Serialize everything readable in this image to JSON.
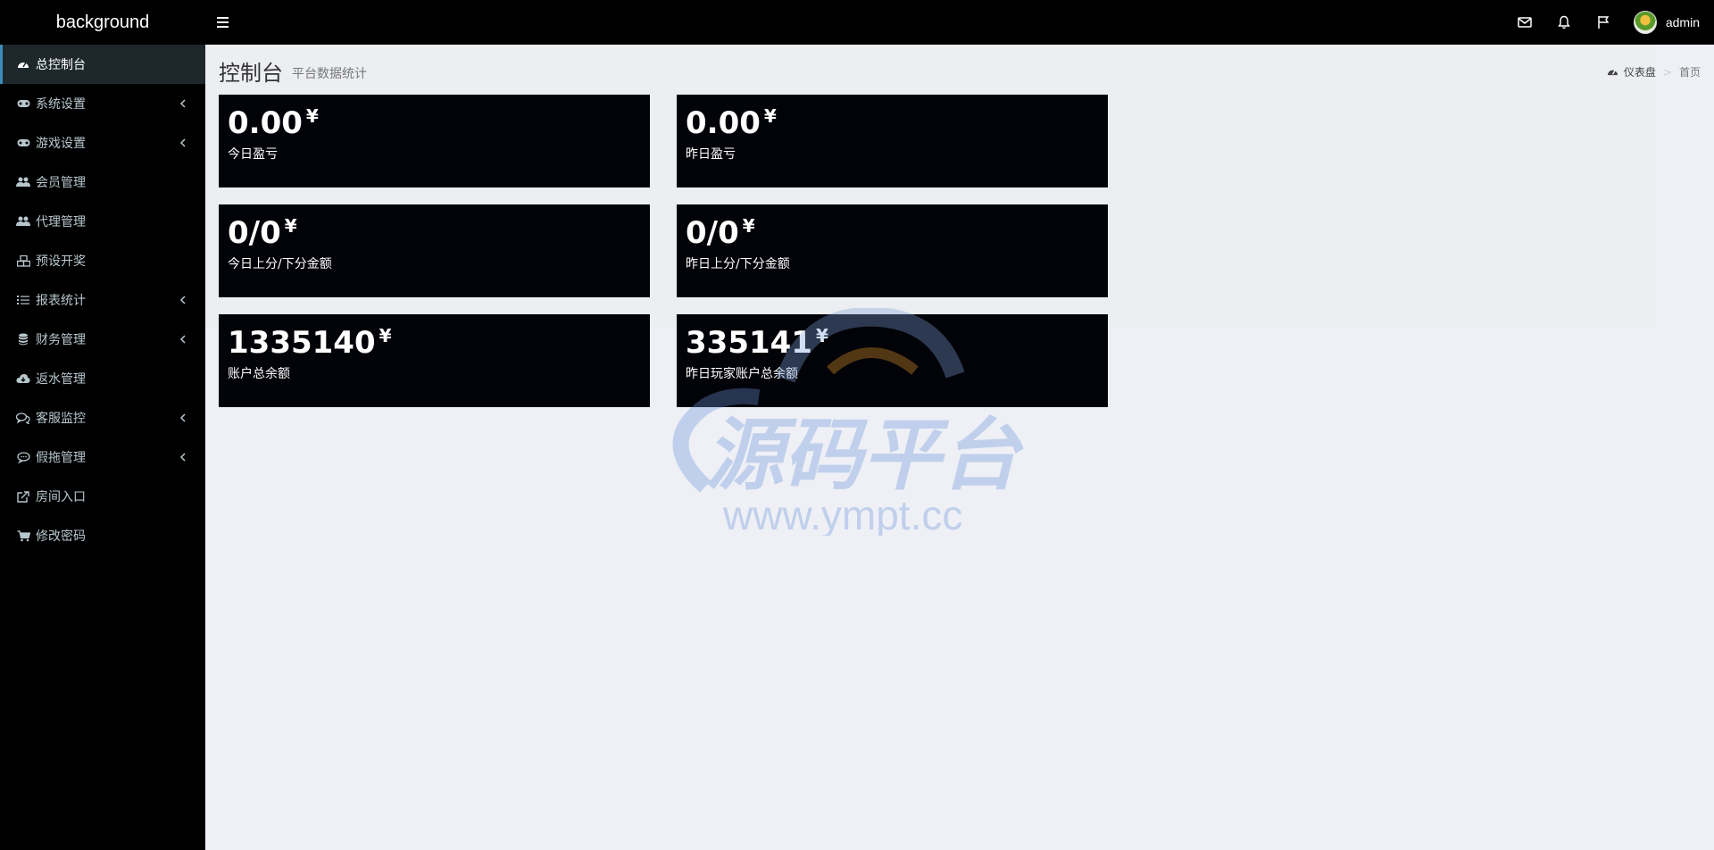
{
  "header": {
    "logo": "background",
    "username": "admin",
    "icons": [
      "menu-toggle-icon",
      "envelope-icon",
      "bell-icon",
      "flag-icon"
    ]
  },
  "sidebar": {
    "items": [
      {
        "label": "总控制台",
        "icon": "dashboard-icon",
        "active": true,
        "has_children": false
      },
      {
        "label": "系统设置",
        "icon": "gamepad-icon",
        "active": false,
        "has_children": true
      },
      {
        "label": "游戏设置",
        "icon": "gamepad-icon",
        "active": false,
        "has_children": true
      },
      {
        "label": "会员管理",
        "icon": "users-icon",
        "active": false,
        "has_children": false
      },
      {
        "label": "代理管理",
        "icon": "users-icon",
        "active": false,
        "has_children": false
      },
      {
        "label": "预设开奖",
        "icon": "cubes-icon",
        "active": false,
        "has_children": false
      },
      {
        "label": "报表统计",
        "icon": "list-icon",
        "active": false,
        "has_children": true
      },
      {
        "label": "财务管理",
        "icon": "database-icon",
        "active": false,
        "has_children": true
      },
      {
        "label": "返水管理",
        "icon": "cloud-download-icon",
        "active": false,
        "has_children": false
      },
      {
        "label": "客服监控",
        "icon": "comments-icon",
        "active": false,
        "has_children": true
      },
      {
        "label": "假拖管理",
        "icon": "comment-icon",
        "active": false,
        "has_children": true
      },
      {
        "label": "房间入口",
        "icon": "external-link-icon",
        "active": false,
        "has_children": false
      },
      {
        "label": "修改密码",
        "icon": "cart-icon",
        "active": false,
        "has_children": false
      }
    ]
  },
  "page": {
    "title": "控制台",
    "subtitle": "平台数据统计",
    "breadcrumb": {
      "home": "仪表盘",
      "current": "首页"
    }
  },
  "stats": [
    {
      "value": "0.00",
      "unit": "¥",
      "label": "今日盈亏"
    },
    {
      "value": "0.00",
      "unit": "¥",
      "label": "昨日盈亏"
    },
    {
      "value": "0/0",
      "unit": "¥",
      "label": "今日上分/下分金额"
    },
    {
      "value": "0/0",
      "unit": "¥",
      "label": "昨日上分/下分金额"
    },
    {
      "value": "1335140",
      "unit": "¥",
      "label": "账户总余额"
    },
    {
      "value": "335141",
      "unit": "¥",
      "label": "昨日玩家账户总余额"
    }
  ],
  "watermark": {
    "text": "源码平台",
    "url": "www.ympt.cc"
  }
}
